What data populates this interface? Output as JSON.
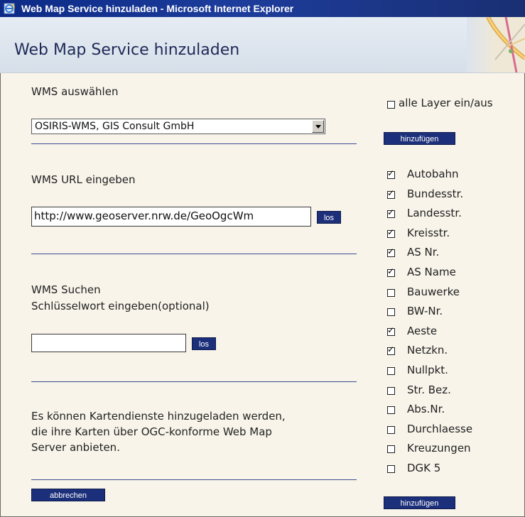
{
  "window": {
    "title": "Web Map Service hinzuladen - Microsoft Internet Explorer"
  },
  "header": {
    "title": "Web Map Service hinzuladen"
  },
  "select_section": {
    "label": "WMS auswählen",
    "selected": "OSIRIS-WMS, GIS Consult GmbH"
  },
  "url_section": {
    "label": "WMS URL eingeben",
    "value": "http://www.geoserver.nrw.de/GeoOgcWm",
    "go_label": "los"
  },
  "search_section": {
    "label_line1": "WMS Suchen",
    "label_line2": "Schlüsselwort eingeben(optional)",
    "value": "",
    "go_label": "los"
  },
  "info": {
    "line1": "Es können Kartendienste hinzugeladen werden,",
    "line2": "die ihre Karten über OGC-konforme Web Map",
    "line3": "Server anbieten."
  },
  "actions": {
    "cancel_label": "abbrechen",
    "add_label_top": "hinzufügen",
    "add_label_bottom": "hinzufügen"
  },
  "layers": {
    "all_toggle_label": "alle Layer ein/aus",
    "all_toggle_checked": false,
    "items": [
      {
        "label": "Autobahn",
        "checked": true
      },
      {
        "label": "Bundesstr.",
        "checked": true
      },
      {
        "label": "Landesstr.",
        "checked": true
      },
      {
        "label": "Kreisstr.",
        "checked": true
      },
      {
        "label": "AS Nr.",
        "checked": true
      },
      {
        "label": "AS Name",
        "checked": true
      },
      {
        "label": "Bauwerke",
        "checked": false
      },
      {
        "label": "BW-Nr.",
        "checked": false
      },
      {
        "label": "Aeste",
        "checked": true
      },
      {
        "label": "Netzkn.",
        "checked": true
      },
      {
        "label": "Nullpkt.",
        "checked": false
      },
      {
        "label": "Str. Bez.",
        "checked": false
      },
      {
        "label": "Abs.Nr.",
        "checked": false
      },
      {
        "label": "Durchlaesse",
        "checked": false
      },
      {
        "label": "Kreuzungen",
        "checked": false
      },
      {
        "label": "DGK 5",
        "checked": false
      }
    ]
  },
  "colors": {
    "titlebar": "#1d3d9c",
    "button": "#1c2f7a",
    "rule": "#3d4b92",
    "background": "#f8f4ea"
  }
}
